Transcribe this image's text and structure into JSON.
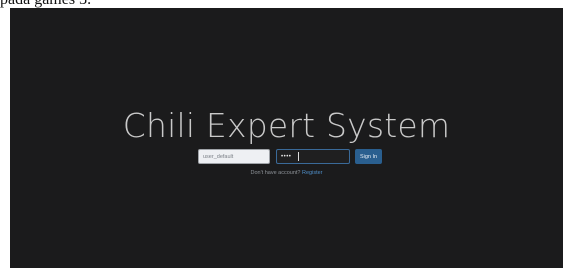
{
  "page_caption": "padā gamēs 3.",
  "app": {
    "title": "Chili Expert System"
  },
  "login_form": {
    "username_value": "user_default",
    "password_value": "••••",
    "signin_label": "Sign In"
  },
  "register": {
    "prompt": "Don't have account?",
    "link_label": "Register"
  },
  "colors": {
    "background": "#1b1b1c",
    "accent": "#2a5f8f",
    "link": "#4f8fc9"
  }
}
